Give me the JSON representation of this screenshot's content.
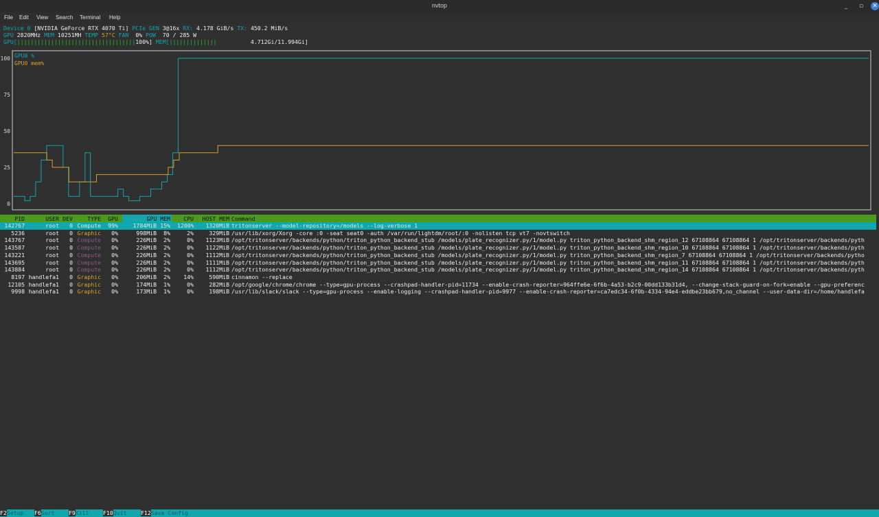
{
  "window": {
    "title": "nvtop",
    "buttons": [
      "_",
      "▫",
      "✕"
    ]
  },
  "menu": [
    "File",
    "Edit",
    "View",
    "Search",
    "Terminal",
    "Help"
  ],
  "device": {
    "label": "Device 0",
    "name": "[NVIDIA GeForce RTX 4070 Ti]",
    "pcie_label": "PCIe GEN",
    "pcie_value": "3@16x",
    "rx_label": "RX:",
    "rx_value": "4.178 GiB/s",
    "tx_label": "TX:",
    "tx_value": "450.2 MiB/s",
    "gpu_label": "GPU",
    "gpu_clock": "2820MHz",
    "mem_label": "MEM",
    "mem_clock": "10251MH",
    "temp_label": "TEMP",
    "temp_value": "57°C",
    "fan_label": "FAN",
    "fan_value": "0%",
    "pow_label": "POW",
    "pow_value": "70 / 285 W",
    "gpu_bar_label": "GPU[",
    "gpu_bar_fill": "|||||||||||||||||||||||||||||||||||",
    "gpu_bar_value": "100%]",
    "gpu_util_fraction": 1.0,
    "mem_bar_label": "MEM[",
    "mem_bar_fill": "||||||||||||||",
    "mem_bar_value": "4.712Gi/11.994Gi]"
  },
  "chart_data": {
    "type": "line",
    "y_ticks": [
      "100",
      "75",
      "50",
      "25",
      "0"
    ],
    "ylim": [
      0,
      100
    ],
    "legend": [
      "GPU0 %",
      "GPU0 mem%"
    ],
    "grid": false,
    "series": [
      {
        "name": "GPU0 %",
        "color": "#11a7ad",
        "values": [
          5,
          5,
          2,
          5,
          15,
          30,
          40,
          40,
          40,
          25,
          5,
          5,
          15,
          35,
          5,
          5,
          5,
          5,
          5,
          10,
          5,
          2,
          2,
          5,
          5,
          10,
          10,
          15,
          20,
          35,
          100,
          100,
          100,
          100,
          100,
          100,
          100,
          100,
          100,
          100,
          100,
          100,
          100,
          100,
          100,
          100,
          100,
          100,
          100,
          100,
          100,
          100,
          100,
          100,
          100,
          100,
          100,
          100,
          100,
          100,
          100,
          100,
          100,
          100,
          100,
          100,
          100,
          100,
          100,
          100,
          100,
          100,
          100,
          100,
          100,
          100,
          100,
          100,
          100,
          100,
          100,
          100,
          100,
          100,
          100,
          100,
          100,
          100,
          100,
          100,
          100,
          100,
          100,
          100,
          100,
          100,
          100,
          100,
          100,
          100,
          100,
          100,
          100,
          100,
          100,
          100,
          100,
          100,
          100,
          100,
          100,
          100,
          100,
          100,
          100,
          100,
          100,
          100,
          100,
          100,
          100,
          100,
          100,
          100,
          100,
          100,
          100,
          100,
          100,
          100,
          100,
          100,
          100,
          100,
          100,
          100,
          100,
          100,
          100,
          100,
          100,
          100,
          100,
          100,
          100,
          100,
          100,
          100,
          100,
          100,
          100,
          100,
          100,
          100,
          100,
          100,
          100
        ]
      },
      {
        "name": "GPU0 mem%",
        "color": "#d6a428",
        "values": [
          35,
          35,
          35,
          35,
          35,
          35,
          30,
          25,
          25,
          25,
          15,
          15,
          15,
          15,
          15,
          20,
          20,
          20,
          20,
          20,
          20,
          20,
          20,
          20,
          20,
          20,
          20,
          20,
          25,
          30,
          35,
          35,
          35,
          35,
          35,
          35,
          35,
          40,
          40,
          40,
          40,
          40,
          40,
          40,
          40,
          40,
          40,
          40,
          40,
          40,
          40,
          40,
          40,
          40,
          40,
          40,
          40,
          40,
          40,
          40,
          40,
          40,
          40,
          40,
          40,
          40,
          40,
          40,
          40,
          40,
          40,
          40,
          40,
          40,
          40,
          40,
          40,
          40,
          40,
          40,
          40,
          40,
          40,
          40,
          40,
          40,
          40,
          40,
          40,
          40,
          40,
          40,
          40,
          40,
          40,
          40,
          40,
          40,
          40,
          40,
          40,
          40,
          40,
          40,
          40,
          40,
          40,
          40,
          40,
          40,
          40,
          40,
          40,
          40,
          40,
          40,
          40,
          40,
          40,
          40,
          40,
          40,
          40,
          40,
          40,
          40,
          40,
          40,
          40,
          40,
          40,
          40,
          40,
          40,
          40,
          40,
          40,
          40,
          40,
          40,
          40,
          40,
          40,
          40,
          40,
          40,
          40,
          40,
          40,
          40,
          40,
          40,
          40,
          40,
          40,
          40
        ]
      }
    ]
  },
  "table": {
    "headers": [
      "PID",
      "USER",
      "DEV",
      "TYPE",
      "GPU",
      "GPU MEM",
      "CPU",
      "HOST MEM",
      "Command"
    ],
    "rows": [
      {
        "pid": "142767",
        "user": "root",
        "dev": "0",
        "type": "Compute",
        "gpu": "99%",
        "gpumem": "1784MiB",
        "mempct": "15%",
        "cpu": "1200%",
        "hostmem": "1320MiB",
        "command": "tritonserver --model-repository=/models --log-verbose 1"
      },
      {
        "pid": "5236",
        "user": "root",
        "dev": "0",
        "type": "Graphic",
        "gpu": "0%",
        "gpumem": "998MiB",
        "mempct": "8%",
        "cpu": "2%",
        "hostmem": "329MiB",
        "command": "/usr/lib/xorg/Xorg -core :0 -seat seat0 -auth /var/run/lightdm/root/:0 -nolisten tcp vt7 -novtswitch"
      },
      {
        "pid": "143767",
        "user": "root",
        "dev": "0",
        "type": "Compute",
        "gpu": "0%",
        "gpumem": "226MiB",
        "mempct": "2%",
        "cpu": "0%",
        "hostmem": "1123MiB",
        "command": "/opt/tritonserver/backends/python/triton_python_backend_stub /models/plate_recognizer.py/1/model.py triton_python_backend_shm_region_12 67108864 67108864 1 /opt/tritonserver/backends/pyth"
      },
      {
        "pid": "143587",
        "user": "root",
        "dev": "0",
        "type": "Compute",
        "gpu": "0%",
        "gpumem": "226MiB",
        "mempct": "2%",
        "cpu": "0%",
        "hostmem": "1122MiB",
        "command": "/opt/tritonserver/backends/python/triton_python_backend_stub /models/plate_recognizer.py/1/model.py triton_python_backend_shm_region_10 67108864 67108864 1 /opt/tritonserver/backends/pyth"
      },
      {
        "pid": "143221",
        "user": "root",
        "dev": "0",
        "type": "Compute",
        "gpu": "0%",
        "gpumem": "226MiB",
        "mempct": "2%",
        "cpu": "0%",
        "hostmem": "1112MiB",
        "command": "/opt/tritonserver/backends/python/triton_python_backend_stub /models/plate_recognizer.py/1/model.py triton_python_backend_shm_region_7 67108864 67108864 1 /opt/tritonserver/backends/pytho"
      },
      {
        "pid": "143695",
        "user": "root",
        "dev": "0",
        "type": "Compute",
        "gpu": "0%",
        "gpumem": "226MiB",
        "mempct": "2%",
        "cpu": "0%",
        "hostmem": "1111MiB",
        "command": "/opt/tritonserver/backends/python/triton_python_backend_stub /models/plate_recognizer.py/1/model.py triton_python_backend_shm_region_11 67108864 67108864 1 /opt/tritonserver/backends/pyth"
      },
      {
        "pid": "143884",
        "user": "root",
        "dev": "0",
        "type": "Compute",
        "gpu": "0%",
        "gpumem": "226MiB",
        "mempct": "2%",
        "cpu": "0%",
        "hostmem": "1112MiB",
        "command": "/opt/tritonserver/backends/python/triton_python_backend_stub /models/plate_recognizer.py/1/model.py triton_python_backend_shm_region_14 67108864 67108864 1 /opt/tritonserver/backends/pyth"
      },
      {
        "pid": "8197",
        "user": "handlefa1",
        "dev": "0",
        "type": "Graphic",
        "gpu": "0%",
        "gpumem": "206MiB",
        "mempct": "2%",
        "cpu": "14%",
        "hostmem": "590MiB",
        "command": "cinnamon --replace"
      },
      {
        "pid": "12105",
        "user": "handlefa1",
        "dev": "0",
        "type": "Graphic",
        "gpu": "0%",
        "gpumem": "174MiB",
        "mempct": "1%",
        "cpu": "0%",
        "hostmem": "282MiB",
        "command": "/opt/google/chrome/chrome --type=gpu-process --crashpad-handler-pid=11734 --enable-crash-reporter=964ffe6e-6f6b-4a53-b2c9-00dd133b31d4, --change-stack-guard-on-fork=enable --gpu-preferenc"
      },
      {
        "pid": "9998",
        "user": "handlefa1",
        "dev": "0",
        "type": "Graphic",
        "gpu": "0%",
        "gpumem": "173MiB",
        "mempct": "1%",
        "cpu": "0%",
        "hostmem": "198MiB",
        "command": "/usr/lib/slack/slack --type=gpu-process --enable-logging --crashpad-handler-pid=9977 --enable-crash-reporter=ca7edc34-6f0b-4334-94e4-eddbe23bb679,no_channel --user-data-dir=/home/handlefa"
      }
    ]
  },
  "footer": [
    {
      "key": "F2",
      "label": "Setup"
    },
    {
      "key": "F6",
      "label": "Sort"
    },
    {
      "key": "F9",
      "label": "Kill"
    },
    {
      "key": "F10",
      "label": "Quit"
    },
    {
      "key": "F12",
      "label": "Save Config"
    }
  ],
  "colors": {
    "cyan": "#11a7ad",
    "yellow": "#d6a428",
    "header_green": "#4c9a1c",
    "background": "#303030"
  }
}
